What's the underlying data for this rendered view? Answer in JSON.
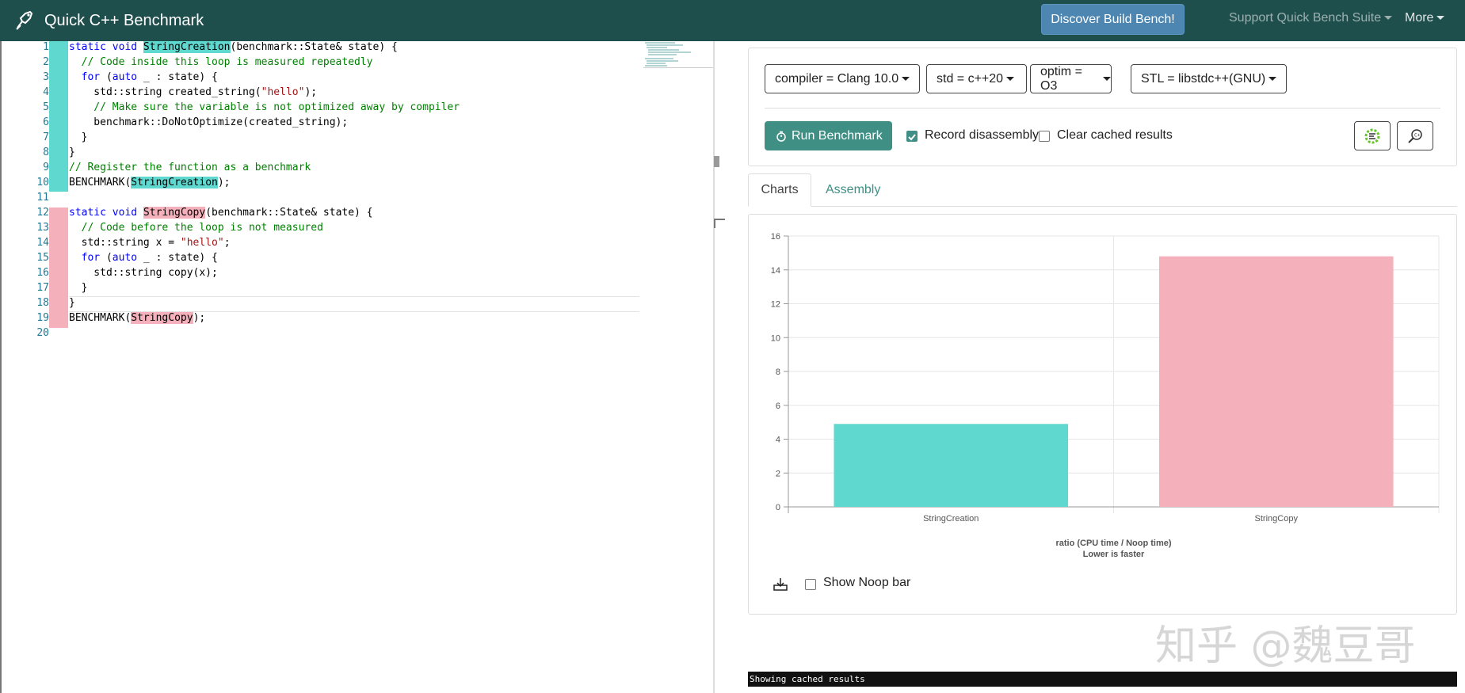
{
  "navbar": {
    "brand": "Quick C++ Benchmark",
    "discover_label": "Discover Build Bench!",
    "support_label": "Support Quick Bench Suite",
    "more_label": "More"
  },
  "editor": {
    "line_numbers": [
      "1",
      "2",
      "3",
      "4",
      "5",
      "6",
      "7",
      "8",
      "9",
      "10",
      "11",
      "12",
      "13",
      "14",
      "15",
      "16",
      "17",
      "18",
      "19",
      "20"
    ],
    "lines": {
      "l1a": "static void ",
      "l1b": "StringCreation",
      "l1c": "(benchmark::State& state) {",
      "l2": "  // Code inside this loop is measured repeatedly",
      "l3a": "  for",
      "l3b": " (",
      "l3c": "auto",
      "l3d": " _ : state) {",
      "l4a": "    std::string created_string(",
      "l4b": "\"hello\"",
      "l4c": ");",
      "l5": "    // Make sure the variable is not optimized away by compiler",
      "l6": "    benchmark::DoNotOptimize(created_string);",
      "l7": "  }",
      "l8": "}",
      "l9": "// Register the function as a benchmark",
      "l10a": "BENCHMARK(",
      "l10b": "StringCreation",
      "l10c": ");",
      "l12a": "static void ",
      "l12b": "StringCopy",
      "l12c": "(benchmark::State& state) {",
      "l13": "  // Code before the loop is not measured",
      "l14a": "  std::string x = ",
      "l14b": "\"hello\"",
      "l14c": ";",
      "l15a": "  for",
      "l15b": " (",
      "l15c": "auto",
      "l15d": " _ : state) {",
      "l16": "    std::string copy(x);",
      "l17": "  }",
      "l18": "}",
      "l19a": "BENCHMARK(",
      "l19b": "StringCopy",
      "l19c": ");"
    }
  },
  "config": {
    "compiler": "compiler = Clang 10.0",
    "std": "std = c++20",
    "optim": "optim = O3",
    "stl": "STL = libstdc++(GNU)",
    "run_label": "Run Benchmark",
    "record_label": "Record disassembly",
    "record_checked": true,
    "clear_label": "Clear cached results",
    "clear_checked": false
  },
  "tabs": {
    "charts": "Charts",
    "assembly": "Assembly"
  },
  "chart_data": {
    "type": "bar",
    "categories": [
      "StringCreation",
      "StringCopy"
    ],
    "values": [
      4.9,
      14.8
    ],
    "colors": [
      "#5fd9cf",
      "#f4b0bb"
    ],
    "yticks": [
      "0",
      "2",
      "4",
      "6",
      "8",
      "10",
      "12",
      "14",
      "16"
    ],
    "ylim": [
      0,
      16
    ],
    "xlabel_line1": "ratio (CPU time / Noop time)",
    "xlabel_line2": "Lower is faster",
    "grid": true
  },
  "chart_footer": {
    "noop_label": "Show Noop bar"
  },
  "status": {
    "text": "Showing cached results"
  },
  "watermark": {
    "text": "知乎 @魏豆哥"
  },
  "colors": {
    "navbar": "#1f4f4d",
    "accent": "#3f8f85",
    "teal": "#5fd9cf",
    "pink": "#f4b0bb"
  }
}
